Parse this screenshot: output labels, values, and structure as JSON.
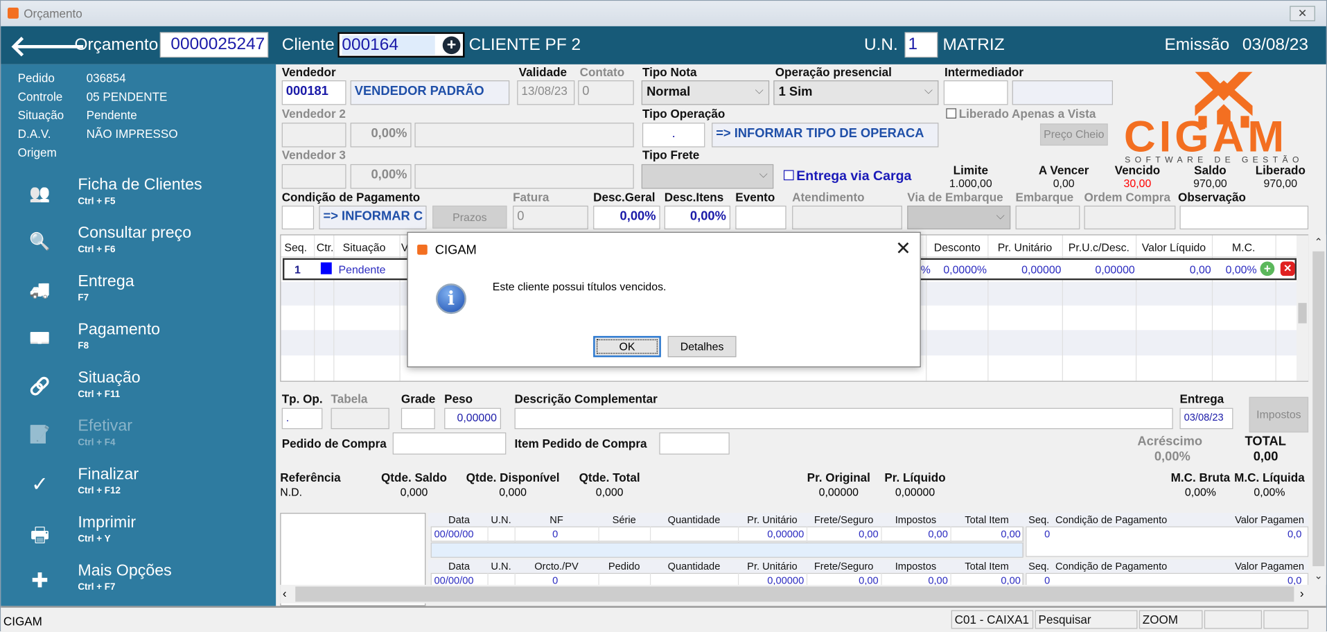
{
  "window": {
    "title": "Orçamento"
  },
  "header": {
    "orcamento_label": "Orçamento",
    "orcamento": "0000025247",
    "cliente_label": "Cliente",
    "cliente_code": "000164",
    "cliente_name": "CLIENTE PF 2",
    "un_label": "U.N.",
    "un": "1",
    "un_name": "MATRIZ",
    "emissao_label": "Emissão",
    "emissao": "03/08/23"
  },
  "info": [
    {
      "label": "Pedido",
      "value": "036854"
    },
    {
      "label": "Controle",
      "value": "05  PENDENTE"
    },
    {
      "label": "Situação",
      "value": "Pendente"
    },
    {
      "label": "D.A.V.",
      "value": "NÃO IMPRESSO"
    },
    {
      "label": "Origem",
      "value": ""
    }
  ],
  "menu": [
    {
      "label": "Ficha de Clientes",
      "shortcut": "Ctrl + F5",
      "icon": "users-icon"
    },
    {
      "label": "Consultar preço",
      "shortcut": "Ctrl + F6",
      "icon": "price-search-icon"
    },
    {
      "label": "Entrega",
      "shortcut": "F7",
      "icon": "truck-icon"
    },
    {
      "label": "Pagamento",
      "shortcut": "F8",
      "icon": "money-icon"
    },
    {
      "label": "Situação",
      "shortcut": "Ctrl + F11",
      "icon": "status-link-icon"
    },
    {
      "label": "Efetivar",
      "shortcut": "Ctrl + F4",
      "icon": "document-check-icon",
      "disabled": true
    },
    {
      "label": "Finalizar",
      "shortcut": "Ctrl + F12",
      "icon": "check-icon"
    },
    {
      "label": "Imprimir",
      "shortcut": "Ctrl + Y",
      "icon": "printer-icon"
    },
    {
      "label": "Mais Opções",
      "shortcut": "Ctrl + F7",
      "icon": "plus-icon"
    }
  ],
  "form": {
    "vendedor_label": "Vendedor",
    "vendedor_code": "000181",
    "vendedor_name": "VENDEDOR PADRÃO",
    "validade_label": "Validade",
    "validade": "13/08/23",
    "contato_label": "Contato",
    "contato": "0",
    "tipo_nota_label": "Tipo Nota",
    "tipo_nota": "Normal",
    "operacao_label": "Operação presencial",
    "operacao": "1 Sim",
    "intermediador_label": "Intermediador",
    "liberado_vista_label": "Liberado Apenas a Vista",
    "preco_cheio": "Preço Cheio",
    "vendedor2_label": "Vendedor 2",
    "vendedor2_pct": "0,00%",
    "tipo_operacao_label": "Tipo Operação",
    "tipo_operacao_code": ".",
    "tipo_operacao_name": "=> INFORMAR TIPO DE OPERACA",
    "vendedor3_label": "Vendedor 3",
    "vendedor3_pct": "0,00%",
    "tipo_frete_label": "Tipo Frete",
    "entrega_carga_label": "Entrega via Carga",
    "condicao_label": "Condição de Pagamento",
    "condicao_name": "=> INFORMAR C",
    "prazos": "Prazos",
    "fatura_label": "Fatura",
    "fatura": "0",
    "desc_geral_label": "Desc.Geral",
    "desc_geral": "0,00%",
    "desc_itens_label": "Desc.Itens",
    "desc_itens": "0,00%",
    "evento_label": "Evento",
    "atendimento_label": "Atendimento",
    "via_embarque_label": "Via de Embarque",
    "embarque_label": "Embarque",
    "ordem_compra_label": "Ordem Compra",
    "observacao_label": "Observação"
  },
  "credit": [
    {
      "label": "Limite",
      "value": "1.000,00"
    },
    {
      "label": "A Vencer",
      "value": "0,00"
    },
    {
      "label": "Vencido",
      "value": "30,00",
      "color": "#ff0000"
    },
    {
      "label": "Saldo",
      "value": "970,00"
    },
    {
      "label": "Liberado",
      "value": "970,00"
    }
  ],
  "logo": {
    "name": "CIGAM",
    "tagline": "SOFTWARE DE GESTÃO",
    "color": "#f36f21"
  },
  "grid": {
    "headers_left": [
      "Seq.",
      "Ctr.",
      "Situação",
      "V"
    ],
    "headers_right": [
      "Desconto",
      "Pr. Unitário",
      "Pr.U.c/Desc.",
      "Valor Líquido",
      "M.C."
    ],
    "row": {
      "seq": "1",
      "status_color": "#0000ff",
      "situacao": "Pendente",
      "partial": "%",
      "desconto": "0,0000%",
      "pr_unitario": "0,00000",
      "pr_desc": "0,00000",
      "valor_liquido": "0,00",
      "mc": "0,00%"
    }
  },
  "dialog": {
    "title": "CIGAM",
    "message": "Este cliente possui títulos vencidos.",
    "ok": "OK",
    "details": "Detalhes"
  },
  "item": {
    "tp_op_label": "Tp. Op.",
    "tp_op": ".",
    "tabela_label": "Tabela",
    "grade_label": "Grade",
    "peso_label": "Peso",
    "peso": "0,00000",
    "desc_comp_label": "Descrição Complementar",
    "entrega_label": "Entrega",
    "entrega": "03/08/23",
    "impostos": "Impostos",
    "pedido_compra_label": "Pedido de Compra",
    "item_pedido_label": "Item Pedido de Compra",
    "acrescimo_label": "Acréscimo",
    "acrescimo": "0,00%",
    "total_label": "TOTAL",
    "total": "0,00"
  },
  "stock": [
    {
      "label": "Referência",
      "value": "N.D."
    },
    {
      "label": "Qtde. Saldo",
      "value": "0,000"
    },
    {
      "label": "Qtde. Disponível",
      "value": "0,000"
    },
    {
      "label": "Qtde. Total",
      "value": "0,000"
    },
    {
      "label": "Pr. Original",
      "value": "0,00000"
    },
    {
      "label": "Pr. Líquido",
      "value": "0,00000"
    },
    {
      "label": "M.C. Bruta",
      "value": "0,00%"
    },
    {
      "label": "M.C. Líquida",
      "value": "0,00%"
    }
  ],
  "history1": {
    "headers": [
      "Data",
      "U.N.",
      "NF",
      "Série",
      "Quantidade",
      "Pr. Unitário",
      "Frete/Seguro",
      "Impostos",
      "Total Item"
    ],
    "row": [
      "00/00/00",
      "",
      "0",
      "",
      "",
      "0,00000",
      "0,00",
      "0,00",
      "0,00"
    ]
  },
  "history2": {
    "headers": [
      "Data",
      "U.N.",
      "Orcto./PV",
      "Pedido",
      "Quantidade",
      "Pr. Unitário",
      "Frete/Seguro",
      "Impostos",
      "Total Item"
    ],
    "row": [
      "00/00/00",
      "",
      "0",
      "",
      "",
      "0,00000",
      "0,00",
      "0,00",
      "0,00"
    ]
  },
  "payments": {
    "headers": [
      "Seq.",
      "Condição de Pagamento",
      "Valor Pagamen"
    ],
    "row": [
      "0",
      "",
      "0,0"
    ]
  },
  "status": {
    "app": "CIGAM",
    "caixa": "C01 - CAIXA1",
    "mode": "Pesquisar",
    "zoom": "ZOOM"
  }
}
